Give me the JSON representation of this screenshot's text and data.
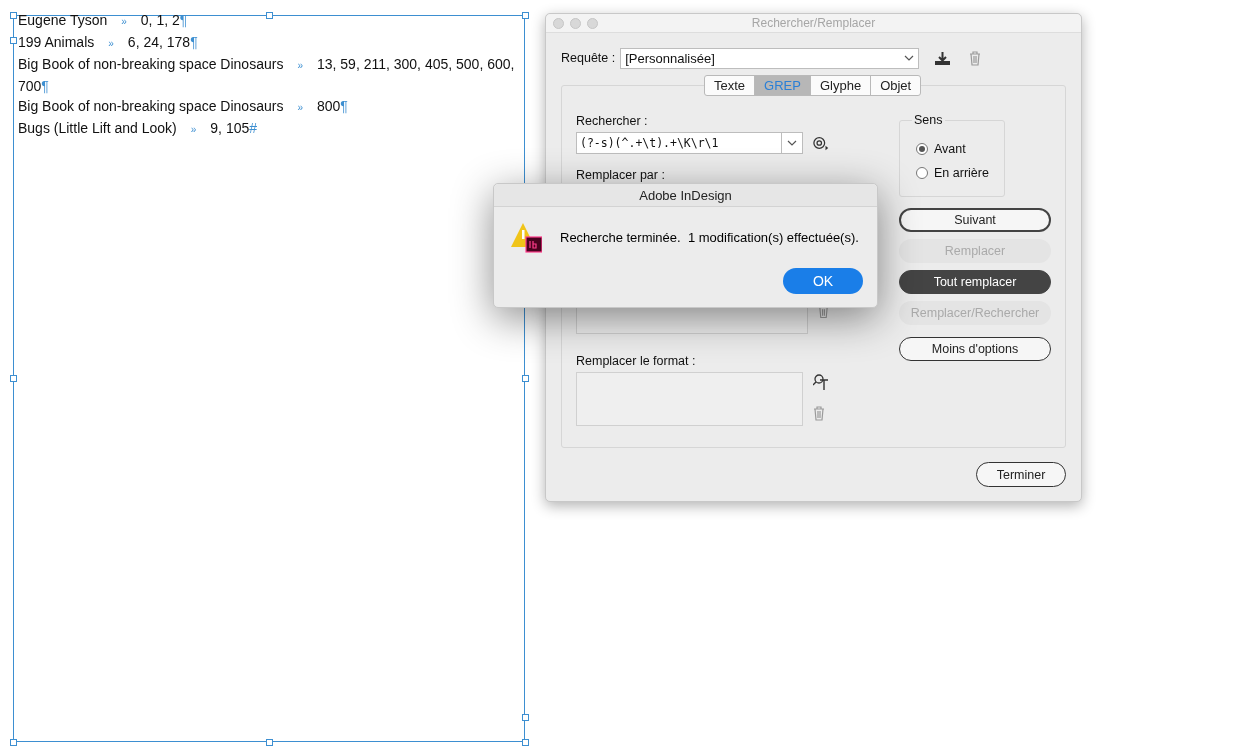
{
  "text_frame": {
    "lines": [
      {
        "title": "Eugene Tyson",
        "tab_mark": "»",
        "pages": "0, 1, 2",
        "end_mark": "¶"
      },
      {
        "title": "199 Animals",
        "tab_mark": "»",
        "pages": "6, 24, 178",
        "end_mark": "¶"
      },
      {
        "title": "Big Book of non-breaking space Dinosaurs",
        "tab_mark": "»",
        "pages": "13, 59, 211, 300, 405, 500, 600, 700",
        "end_mark": "¶"
      },
      {
        "title": "Big Book of non-breaking space Dinosaurs",
        "tab_mark": "»",
        "pages": "800",
        "end_mark": "¶"
      },
      {
        "title": "Bugs (Little Lift and Look)",
        "tab_mark": "»",
        "pages": "9, 105",
        "end_mark": "#"
      }
    ]
  },
  "find_dialog": {
    "title": "Rechercher/Remplacer",
    "query": {
      "label": "Requête :",
      "value": "[Personnalisée]"
    },
    "tabs": [
      {
        "label": "Texte",
        "selected": false
      },
      {
        "label": "GREP",
        "selected": true
      },
      {
        "label": "Glyphe",
        "selected": false
      },
      {
        "label": "Objet",
        "selected": false
      }
    ],
    "find": {
      "label": "Rechercher :",
      "value": "(?-s)(^.+\\t).+\\K\\r\\1"
    },
    "replace": {
      "label": "Remplacer par :"
    },
    "replace_format": {
      "label": "Remplacer le format :"
    },
    "direction": {
      "label": "Sens",
      "options": [
        {
          "label": "Avant",
          "selected": true
        },
        {
          "label": "En arrière",
          "selected": false
        }
      ]
    },
    "buttons": [
      {
        "label": "Suivant",
        "kind": "default",
        "disabled": false
      },
      {
        "label": "Remplacer",
        "kind": "plain",
        "disabled": true
      },
      {
        "label": "Tout remplacer",
        "kind": "dark",
        "disabled": false
      },
      {
        "label": "Remplacer/Rechercher",
        "kind": "plain",
        "disabled": true
      },
      {
        "label": "Moins d'options",
        "kind": "plain",
        "disabled": false
      }
    ],
    "done_button": "Terminer"
  },
  "alert": {
    "title": "Adobe InDesign",
    "message": "Recherche terminée.  1 modification(s) effectuée(s).",
    "ok_button": "OK"
  }
}
